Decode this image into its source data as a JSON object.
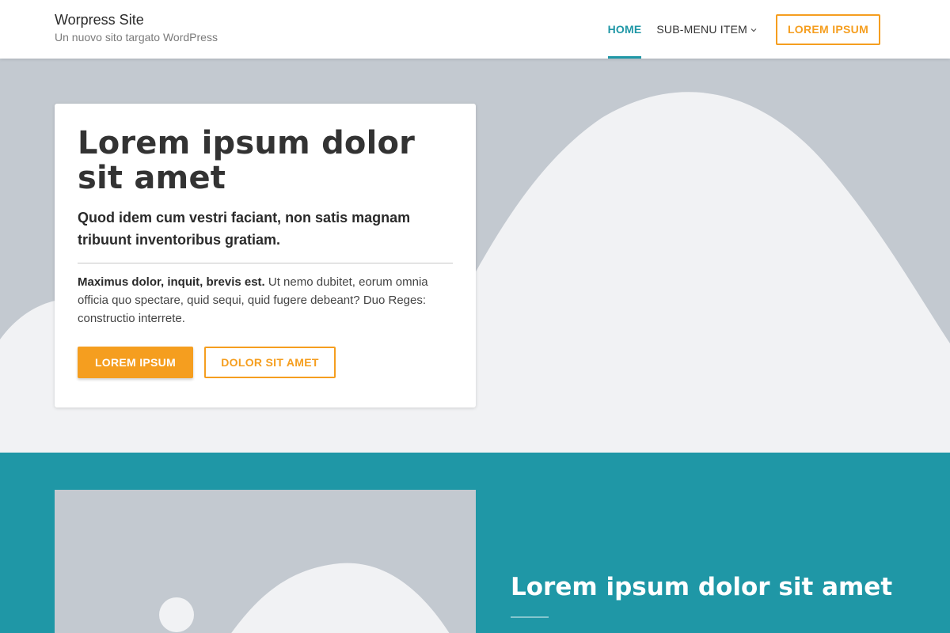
{
  "header": {
    "site_title": "Worpress Site",
    "tagline": "Un nuovo sito targato WordPress",
    "nav": {
      "home": "HOME",
      "submenu": "SUB-MENU ITEM",
      "cta": "LOREM IPSUM"
    }
  },
  "hero": {
    "title": "Lorem ipsum dolor sit amet",
    "subtitle": "Quod idem cum vestri faciant, non satis magnam tribuunt inventoribus gratiam.",
    "text_bold": "Maximus dolor, inquit, brevis est.",
    "text": " Ut nemo dubitet, eorum omnia officia quo spectare, quid sequi, quid fugere debeant? Duo Reges: constructio interrete.",
    "primary_button": "LOREM IPSUM",
    "secondary_button": "DOLOR SIT AMET"
  },
  "feature": {
    "title": "Lorem ipsum dolor sit amet"
  },
  "colors": {
    "accent_teal": "#1f97a6",
    "accent_orange": "#f59e1f",
    "placeholder_gray": "#c3c9d0",
    "placeholder_light": "#f1f2f4"
  },
  "icons": {
    "submenu_indicator": "chevron-down-icon"
  }
}
